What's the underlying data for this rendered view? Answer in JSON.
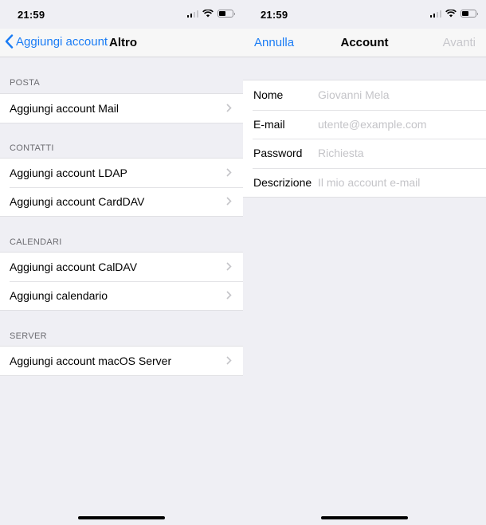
{
  "left": {
    "status_time": "21:59",
    "nav": {
      "back_label": "Aggiungi account",
      "title": "Altro"
    },
    "sections": [
      {
        "header": "POSTA",
        "items": [
          "Aggiungi account Mail"
        ]
      },
      {
        "header": "CONTATTI",
        "items": [
          "Aggiungi account LDAP",
          "Aggiungi account CardDAV"
        ]
      },
      {
        "header": "CALENDARI",
        "items": [
          "Aggiungi account CalDAV",
          "Aggiungi calendario"
        ]
      },
      {
        "header": "SERVER",
        "items": [
          "Aggiungi account macOS Server"
        ]
      }
    ]
  },
  "right": {
    "status_time": "21:59",
    "nav": {
      "cancel_label": "Annulla",
      "title": "Account",
      "next_label": "Avanti"
    },
    "form": {
      "fields": [
        {
          "label": "Nome",
          "placeholder": "Giovanni Mela"
        },
        {
          "label": "E-mail",
          "placeholder": "utente@example.com"
        },
        {
          "label": "Password",
          "placeholder": "Richiesta"
        },
        {
          "label": "Descrizione",
          "placeholder": "Il mio account e-mail"
        }
      ]
    }
  },
  "colors": {
    "accent": "#1a7cf5",
    "disabled": "#c7c7cc",
    "background": "#efeff4"
  },
  "icons": {
    "back": "chevron-left-icon",
    "disclosure": "chevron-right-icon",
    "signal": "cellular-signal-icon",
    "wifi": "wifi-icon",
    "battery": "battery-icon"
  },
  "battery_level": 0.5
}
